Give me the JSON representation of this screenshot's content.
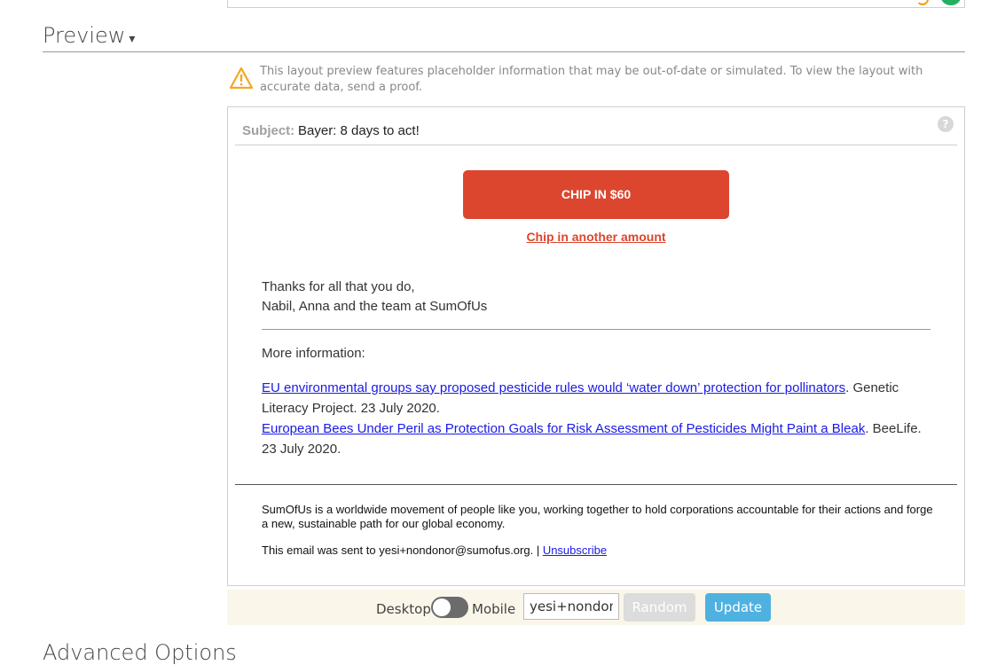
{
  "preview_section": {
    "title": "Preview",
    "caret": "▾"
  },
  "warning": {
    "icon": "warning-triangle-icon",
    "text": "This layout preview features placeholder information that may be out-of-date or simulated. To view the layout with accurate data, send a proof."
  },
  "email": {
    "subject_label": "Subject:",
    "subject": "Bayer: 8 days to act!",
    "help_icon": "?",
    "chip_button": "CHIP IN $60",
    "chip_other": "Chip in another amount",
    "signoff_line1": "Thanks for all that you do,",
    "signoff_line2": "Nabil, Anna and the team at SumOfUs",
    "more_info": "More information:",
    "refs": [
      {
        "link": "EU environmental groups say proposed pesticide rules would ‘water down’ protection for pollinators",
        "rest": ". Genetic Literacy Project. 23 July 2020."
      },
      {
        "link": "European Bees Under Peril as Protection Goals for Risk Assessment of Pesticides Might Paint a Bleak",
        "rest": ". BeeLife. 23 July 2020."
      }
    ],
    "footer_about": "SumOfUs is a worldwide movement of people like you, working together to hold corporations accountable for their actions and forge a new, sustainable path for our global economy.",
    "footer_sent": "This email was sent to yesi+nondonor@sumofus.org. | ",
    "unsubscribe": "Unsubscribe"
  },
  "controls": {
    "desktop_label": "Desktop",
    "mobile_label": "Mobile",
    "email_value": "yesi+nondonor@sumofus.org",
    "random_label": "Random",
    "update_label": "Update"
  },
  "advanced": {
    "title": "Advanced Options"
  },
  "colors": {
    "accent_red": "#dd462e",
    "update_blue": "#4fb1e0",
    "warning_orange": "#f5a623"
  }
}
